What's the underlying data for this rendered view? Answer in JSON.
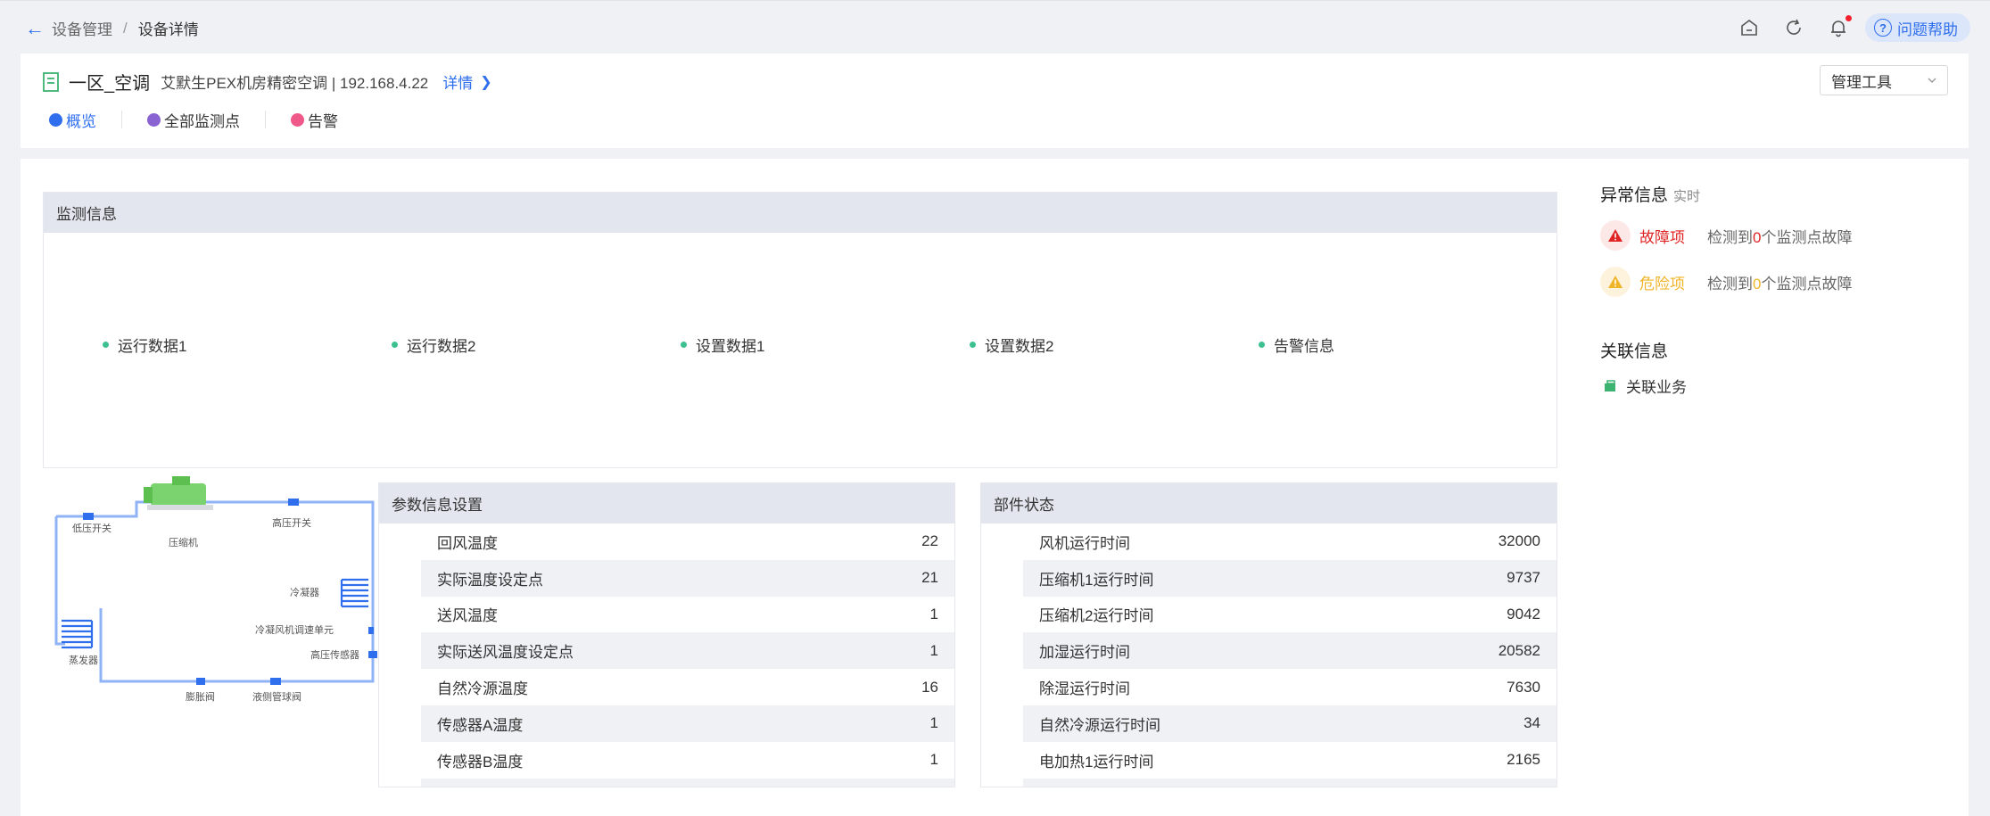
{
  "breadcrumb": {
    "parent": "设备管理",
    "separator": "/",
    "current": "设备详情"
  },
  "topbar": {
    "help_label": "问题帮助"
  },
  "device": {
    "name": "一区_空调",
    "description": "艾默生PEX机房精密空调 | 192.168.4.22",
    "detail_link": "详情",
    "tool_select": "管理工具"
  },
  "tabs": [
    {
      "label": "概览",
      "color": "#2f6fed"
    },
    {
      "label": "全部监测点",
      "color": "#8a63d2"
    },
    {
      "label": "告警",
      "color": "#f0588a"
    }
  ],
  "monitor": {
    "title": "监测信息",
    "items": [
      "运行数据1",
      "运行数据2",
      "设置数据1",
      "设置数据2",
      "告警信息"
    ]
  },
  "abnormal": {
    "title": "异常信息",
    "realtime": "实时",
    "rows": [
      {
        "label": "故障项",
        "prefix": "检测到",
        "count": "0",
        "suffix": "个监测点故障",
        "color": "#e02424"
      },
      {
        "label": "危险项",
        "prefix": "检测到",
        "count": "0",
        "suffix": "个监测点故障",
        "color": "#f0b429"
      }
    ]
  },
  "related": {
    "title": "关联信息",
    "item": "关联业务"
  },
  "diagram": {
    "labels": {
      "low_switch": "低压开关",
      "compressor": "压缩机",
      "high_switch": "高压开关",
      "condenser": "冷凝器",
      "fan_speed": "冷凝风机调速单元",
      "high_sensor": "高压传感器",
      "evaporator": "蒸发器",
      "expansion": "膨胀阀",
      "liquid_valve": "液侧管球阀"
    }
  },
  "params": {
    "title": "参数信息设置",
    "rows": [
      {
        "name": "回风温度",
        "value": "22"
      },
      {
        "name": "实际温度设定点",
        "value": "21"
      },
      {
        "name": "送风温度",
        "value": "1"
      },
      {
        "name": "实际送风温度设定点",
        "value": "1"
      },
      {
        "name": "自然冷源温度",
        "value": "16"
      },
      {
        "name": "传感器A温度",
        "value": "1"
      },
      {
        "name": "传感器B温度",
        "value": "1"
      }
    ]
  },
  "parts": {
    "title": "部件状态",
    "rows": [
      {
        "name": "风机运行时间",
        "value": "32000"
      },
      {
        "name": "压缩机1运行时间",
        "value": "9737"
      },
      {
        "name": "压缩机2运行时间",
        "value": "9042"
      },
      {
        "name": "加湿运行时间",
        "value": "20582"
      },
      {
        "name": "除湿运行时间",
        "value": "7630"
      },
      {
        "name": "自然冷源运行时间",
        "value": "34"
      },
      {
        "name": "电加热1运行时间",
        "value": "2165"
      }
    ]
  }
}
